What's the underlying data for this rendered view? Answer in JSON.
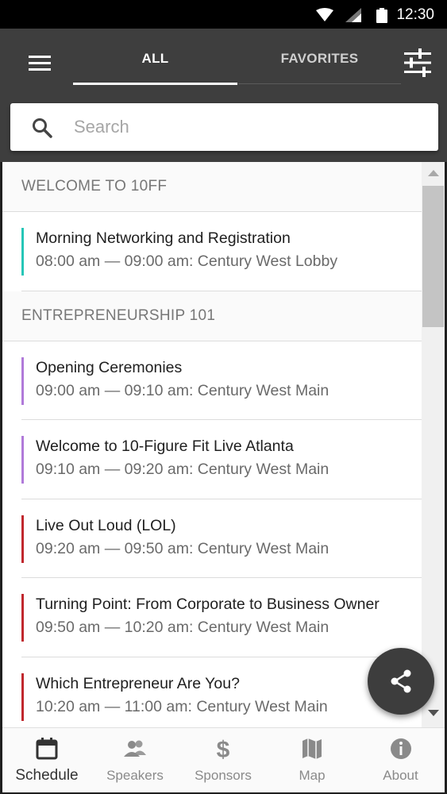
{
  "status_bar": {
    "time": "12:30"
  },
  "header": {
    "tabs": [
      {
        "label": "ALL",
        "active": true
      },
      {
        "label": "FAVORITES",
        "active": false
      }
    ]
  },
  "search": {
    "placeholder": "Search",
    "value": ""
  },
  "sections": [
    {
      "title": "WELCOME TO 10FF",
      "sessions": [
        {
          "title": "Morning Networking and Registration",
          "meta": "08:00 am — 09:00 am: Century West Lobby",
          "color": "#26c6b7"
        }
      ]
    },
    {
      "title": "ENTREPRENEURSHIP 101",
      "sessions": [
        {
          "title": "Opening Ceremonies",
          "meta": "09:00 am — 09:10 am: Century West Main",
          "color": "#b07ad9"
        },
        {
          "title": "Welcome to 10-Figure Fit Live Atlanta",
          "meta": "09:10 am — 09:20 am: Century West Main",
          "color": "#b07ad9"
        },
        {
          "title": "Live Out Loud (LOL)",
          "meta": "09:20 am — 09:50 am: Century West Main",
          "color": "#c0272d"
        },
        {
          "title": "Turning Point: From Corporate to Business Owner",
          "meta": "09:50 am — 10:20 am: Century West Main",
          "color": "#c0272d"
        },
        {
          "title": "Which Entrepreneur Are You?",
          "meta": "10:20 am — 11:00 am: Century West Main",
          "color": "#c0272d"
        }
      ]
    }
  ],
  "bottom_nav": [
    {
      "label": "Schedule",
      "icon": "calendar-icon",
      "active": true
    },
    {
      "label": "Speakers",
      "icon": "people-icon",
      "active": false
    },
    {
      "label": "Sponsors",
      "icon": "dollar-icon",
      "active": false
    },
    {
      "label": "Map",
      "icon": "map-icon",
      "active": false
    },
    {
      "label": "About",
      "icon": "info-icon",
      "active": false
    }
  ],
  "fab": {
    "icon": "share-icon"
  }
}
